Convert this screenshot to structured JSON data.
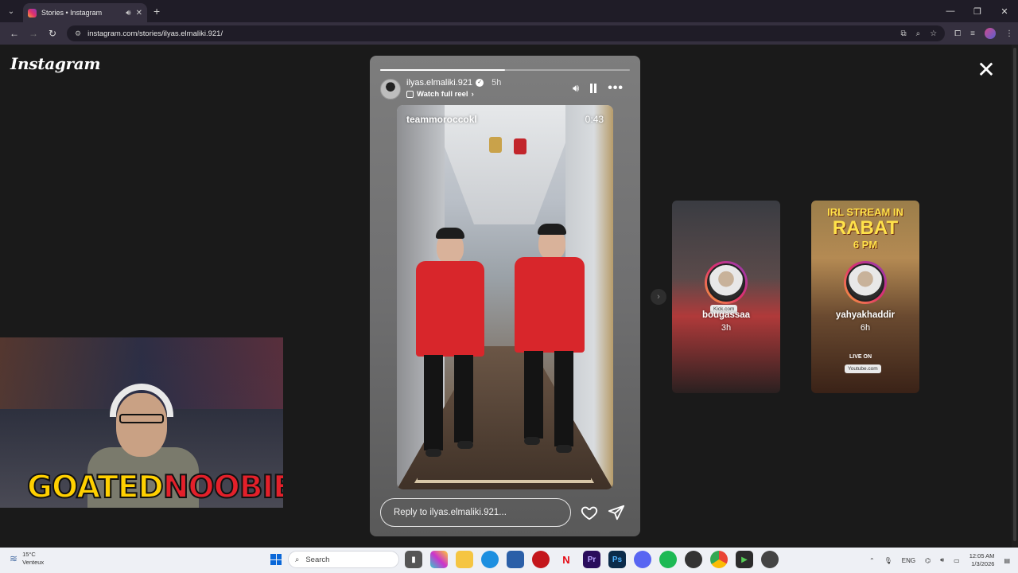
{
  "browser": {
    "tab_title": "Stories • Instagram",
    "url": "instagram.com/stories/ilyas.elmaliki.921/",
    "new_tab_symbol": "+",
    "tab_close_symbol": "✕",
    "window_controls": [
      "—",
      "❐",
      "✕"
    ]
  },
  "page": {
    "logo_text": "Instagram",
    "close_symbol": "✕"
  },
  "story": {
    "progress": 0.5,
    "username": "ilyas.elmaliki.921",
    "verified_mark": "✓",
    "time_ago": "5h",
    "watch_full_reel": "Watch full reel",
    "reel_username": "teammoroccokl",
    "reel_duration": "0:43",
    "reply_placeholder": "Reply to ilyas.elmaliki.921..."
  },
  "next_previews": [
    {
      "username": "bougassaa",
      "time_ago": "3h",
      "tag": "Kick.com"
    },
    {
      "username": "yahyakhaddir",
      "time_ago": "6h",
      "headline": [
        "IRL STREAM IN",
        "RABAT",
        "6 PM"
      ],
      "live_text": "LIVE ON",
      "tag": "Youtube.com"
    }
  ],
  "webcam": {
    "overlay_part1": "GOATED",
    "overlay_part2": "NOOBIE"
  },
  "taskbar": {
    "weather_temp": "15°C",
    "weather_desc": "Venteux",
    "search_placeholder": "Search",
    "language": "ENG",
    "time": "12:05 AM",
    "date": "1/3/2026"
  },
  "colors": {
    "instagram_gradient": [
      "#f9a43a",
      "#e1306c",
      "#8a3ab9"
    ],
    "jersey_red": "#d8262b",
    "page_bg": "#1a1a1a"
  }
}
